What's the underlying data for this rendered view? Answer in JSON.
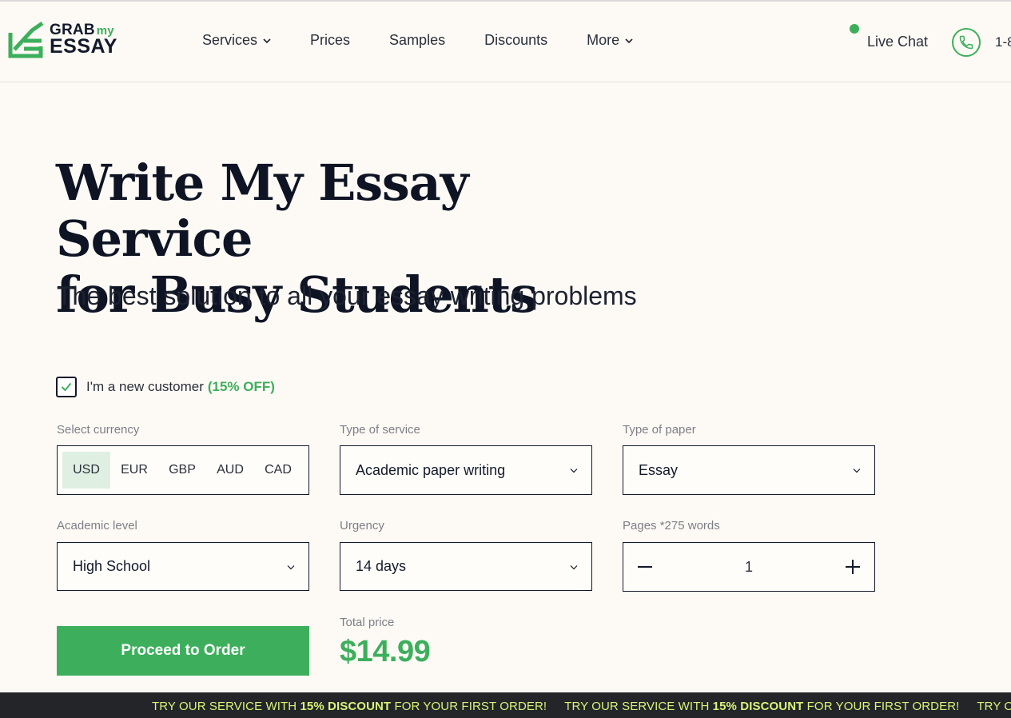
{
  "brand": {
    "line1": "GRAB",
    "line1_accent": "my",
    "line2": "ESSAY",
    "color": "#3daf5c"
  },
  "nav": {
    "items": [
      {
        "label": "Services",
        "has_dropdown": true
      },
      {
        "label": "Prices",
        "has_dropdown": false
      },
      {
        "label": "Samples",
        "has_dropdown": false
      },
      {
        "label": "Discounts",
        "has_dropdown": false
      },
      {
        "label": "More",
        "has_dropdown": true
      }
    ],
    "live_chat": "Live Chat",
    "phone_partial": "1-8"
  },
  "hero": {
    "title_line1": "Write My Essay Service",
    "title_line2": "for Busy Students",
    "subtitle": "The best solution to all your essay writing problems"
  },
  "form": {
    "new_customer": {
      "label": "I'm a new customer",
      "discount": "(15% OFF)",
      "checked": true
    },
    "currency": {
      "label": "Select currency",
      "options": [
        "USD",
        "EUR",
        "GBP",
        "AUD",
        "CAD"
      ],
      "selected": "USD"
    },
    "service": {
      "label": "Type of service",
      "value": "Academic paper writing"
    },
    "paper": {
      "label": "Type of paper",
      "value": "Essay"
    },
    "level": {
      "label": "Academic level",
      "value": "High School"
    },
    "urgency": {
      "label": "Urgency",
      "value": "14 days"
    },
    "pages": {
      "label": "Pages *275 words",
      "value": "1"
    },
    "total": {
      "label": "Total price",
      "value": "$14.99"
    },
    "proceed_label": "Proceed to Order"
  },
  "banner": {
    "pre": "TRY OUR SERVICE WITH ",
    "bold": "15% DISCOUNT",
    "post": " FOR YOUR FIRST ORDER!",
    "partial": "TRY OUR S"
  },
  "colors": {
    "accent": "#3daf5c",
    "background": "#fdfaf5",
    "banner_bg": "#232528",
    "banner_text": "#d9f37a"
  }
}
